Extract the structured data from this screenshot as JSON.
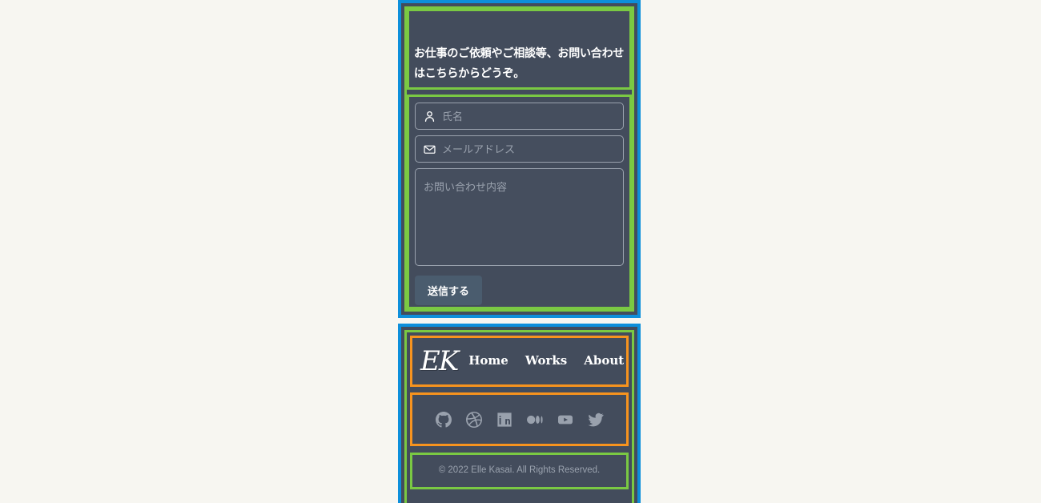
{
  "theme": {
    "page_background": "#f7f6f1",
    "panel_background": "#434c5c",
    "outer_border_color": "#0d8fdb",
    "middle_border_color": "#7ac943",
    "inner_border_color": "#f7931e",
    "placeholder_color": "#9aa2ae",
    "text_color": "#ffffff",
    "button_background": "#4a5c6e"
  },
  "contact": {
    "heading": "お仕事のご依頼やご相談等、お問い合わせはこちらからどうぞ。",
    "fields": {
      "name": {
        "placeholder": "氏名",
        "value": "",
        "icon": "person-icon"
      },
      "email": {
        "placeholder": "メールアドレス",
        "value": "",
        "icon": "envelope-icon"
      },
      "message": {
        "placeholder": "お問い合わせ内容",
        "value": ""
      }
    },
    "submit_label": "送信する"
  },
  "footer": {
    "logo": "EK",
    "nav": [
      {
        "label": "Home"
      },
      {
        "label": "Works"
      },
      {
        "label": "About"
      }
    ],
    "social": [
      {
        "name": "github-icon",
        "label": "GitHub"
      },
      {
        "name": "dribbble-icon",
        "label": "Dribbble"
      },
      {
        "name": "linkedin-icon",
        "label": "LinkedIn"
      },
      {
        "name": "medium-icon",
        "label": "Medium"
      },
      {
        "name": "youtube-icon",
        "label": "YouTube"
      },
      {
        "name": "twitter-icon",
        "label": "Twitter"
      }
    ],
    "copyright": "© 2022 Elle Kasai. All Rights Reserved."
  }
}
